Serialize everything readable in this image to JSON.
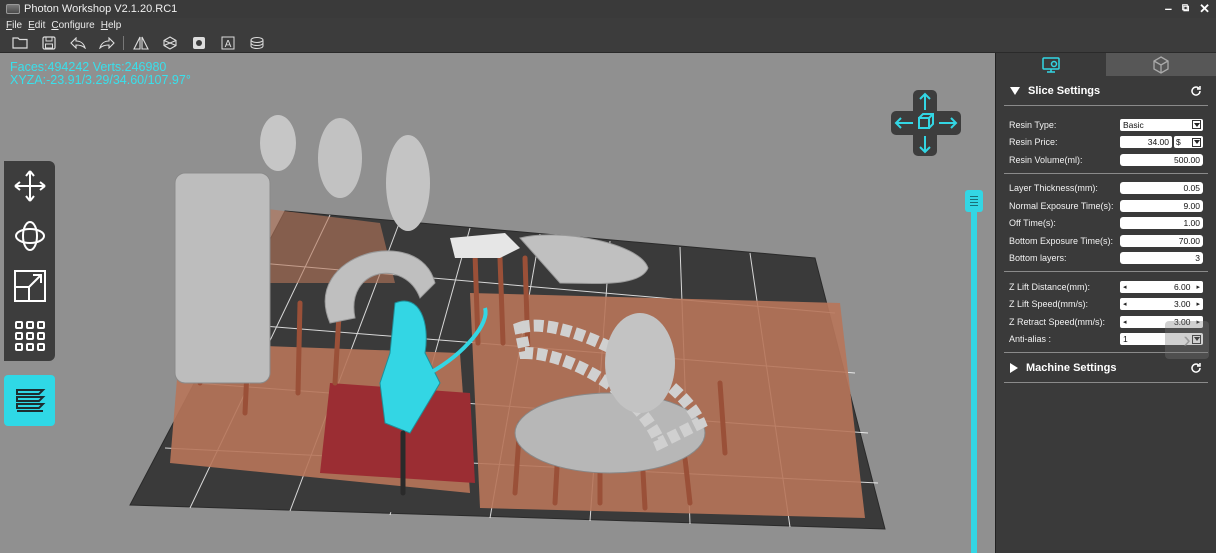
{
  "window": {
    "title": "Photon Workshop V2.1.20.RC1",
    "controls": [
      "minimize",
      "restore",
      "close"
    ]
  },
  "menu": [
    "File",
    "Edit",
    "Configure",
    "Help"
  ],
  "toolbar": {
    "buttons": [
      "open-file-icon",
      "save-icon",
      "undo-icon",
      "redo-icon",
      "mirror-icon",
      "hollow-icon",
      "punch-hole-icon",
      "text-icon",
      "slice-cube-icon"
    ]
  },
  "viewport": {
    "faces_line": "Faces:494242  Verts:246980",
    "xyza_line": "XYZA:-23.91/3.29/34.60/107.97°",
    "left_tools": [
      "move-icon",
      "rotate-icon",
      "scale-icon",
      "layout-grid-icon"
    ],
    "layers_tool": "layers-icon",
    "accent": "#33d6e4"
  },
  "panel": {
    "tabs": [
      "slice-settings-tab-icon",
      "machine-tab-icon"
    ],
    "slice_settings": {
      "title": "Slice Settings",
      "resin_type": {
        "label": "Resin Type:",
        "value": "Basic"
      },
      "resin_price": {
        "label": "Resin Price:",
        "value": "34.00",
        "currency": "$"
      },
      "resin_volume": {
        "label": "Resin Volume(ml):",
        "value": "500.00"
      },
      "layer_thickness": {
        "label": "Layer Thickness(mm):",
        "value": "0.05"
      },
      "normal_exposure": {
        "label": "Normal Exposure Time(s):",
        "value": "9.00"
      },
      "off_time": {
        "label": "Off Time(s):",
        "value": "1.00"
      },
      "bottom_exposure": {
        "label": "Bottom Exposure Time(s):",
        "value": "70.00"
      },
      "bottom_layers": {
        "label": "Bottom layers:",
        "value": "3"
      },
      "z_lift_distance": {
        "label": "Z Lift Distance(mm):",
        "value": "6.00"
      },
      "z_lift_speed": {
        "label": "Z Lift Speed(mm/s):",
        "value": "3.00"
      },
      "z_retract_speed": {
        "label": "Z Retract Speed(mm/s):",
        "value": "3.00"
      },
      "anti_alias": {
        "label": "Anti-alias :",
        "value": "1"
      }
    },
    "machine_settings": {
      "title": "Machine Settings"
    }
  }
}
